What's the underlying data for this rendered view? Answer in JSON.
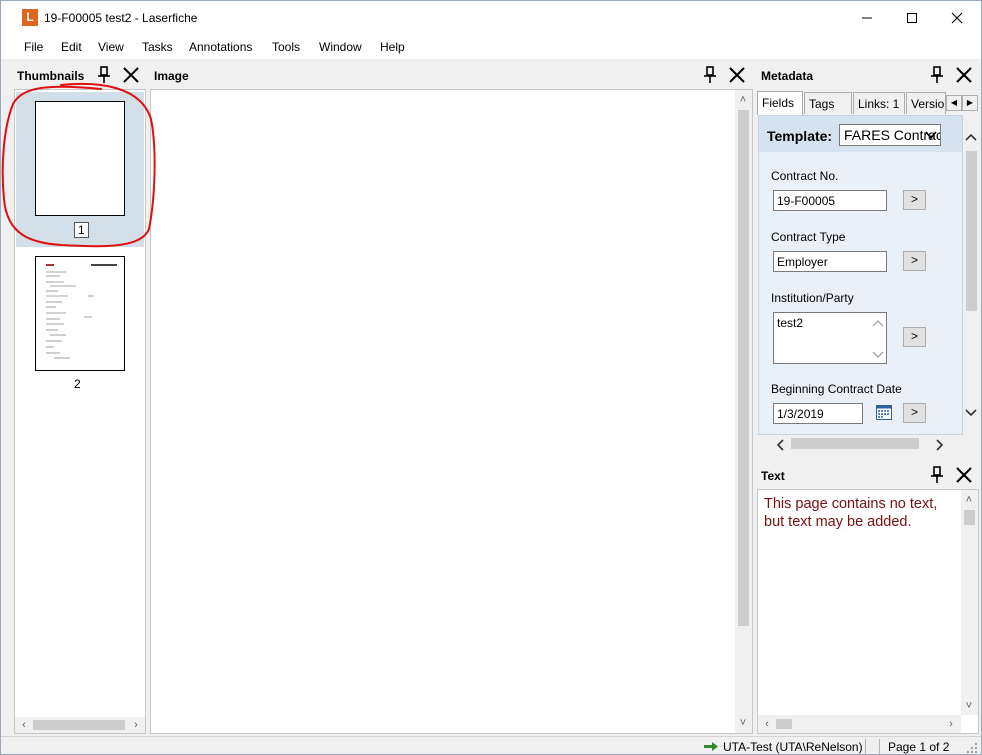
{
  "window": {
    "app_logo_letter": "L",
    "title": "19-F00005 test2 - Laserfiche",
    "accent_color": "#e0661e"
  },
  "menu": {
    "items": [
      "File",
      "Edit",
      "View",
      "Tasks",
      "Annotations",
      "Tools",
      "Window",
      "Help"
    ]
  },
  "thumbnails": {
    "title": "Thumbnails",
    "pages": [
      {
        "number": "1",
        "selected": true
      },
      {
        "number": "2",
        "selected": false
      }
    ]
  },
  "image": {
    "title": "Image"
  },
  "metadata": {
    "title": "Metadata",
    "tabs": [
      "Fields",
      "Tags",
      "Links: 1",
      "Versions"
    ],
    "active_tab": "Fields",
    "template_label": "Template:",
    "template_value": "FARES Contract",
    "fields": [
      {
        "label": "Contract No.",
        "value": "19-F00005"
      },
      {
        "label": "Contract Type",
        "value": "Employer"
      },
      {
        "label": "Institution/Party",
        "value": "test2"
      },
      {
        "label": "Beginning Contract Date",
        "value": "1/3/2019"
      }
    ],
    "go_label": ">"
  },
  "text_panel": {
    "title": "Text",
    "message": "This page contains no text, but text may be added."
  },
  "status": {
    "repository": "UTA-Test (UTA\\ReNelson)",
    "page": "Page 1 of 2"
  },
  "colors": {
    "selection": "#d3dfe8",
    "form_bg": "#e9f0f8",
    "text_message": "#7a1010",
    "annotation": "#e01010"
  }
}
